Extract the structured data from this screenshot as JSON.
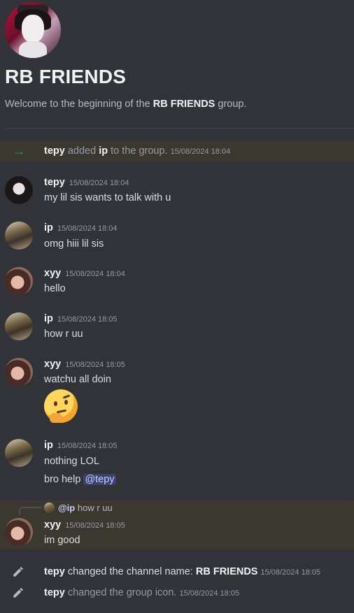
{
  "group": {
    "title": "RB FRIENDS",
    "welcome_prefix": "Welcome to the beginning of the ",
    "welcome_name": "RB FRIENDS",
    "welcome_suffix": " group."
  },
  "system_add": {
    "actor": "tepy",
    "verb": " added ",
    "target": "ip",
    "rest": " to the group.",
    "timestamp": "15/08/2024 18:04"
  },
  "messages": [
    {
      "author": "tepy",
      "timestamp": "15/08/2024 18:04",
      "lines": [
        "my lil sis wants to talk with u"
      ]
    },
    {
      "author": "ip",
      "timestamp": "15/08/2024 18:04",
      "lines": [
        "omg hiii lil sis"
      ]
    },
    {
      "author": "xyy",
      "timestamp": "15/08/2024 18:04",
      "lines": [
        "hello"
      ]
    },
    {
      "author": "ip",
      "timestamp": "15/08/2024 18:05",
      "lines": [
        "how r uu"
      ]
    },
    {
      "author": "xyy",
      "timestamp": "15/08/2024 18:05",
      "lines": [
        "watchu all doin"
      ],
      "emoji": "thinking-face"
    },
    {
      "author": "ip",
      "timestamp": "15/08/2024 18:05",
      "lines": [
        "nothing LOL",
        "bro help "
      ],
      "mention": "@tepy"
    },
    {
      "author": "xyy",
      "timestamp": "15/08/2024 18:05",
      "lines": [
        "im good"
      ],
      "reply_to": {
        "author": "@ip",
        "text": "how r uu"
      }
    }
  ],
  "system_rename": {
    "actor": "tepy",
    "text": " changed the channel name: ",
    "new_name": "RB FRIENDS",
    "timestamp": "15/08/2024 18:05"
  },
  "system_icon": {
    "actor": "tepy",
    "text": " changed the group icon.",
    "timestamp": "15/08/2024 18:05"
  },
  "colors": {
    "background": "#313338",
    "highlight": "#3b3830",
    "join_arrow": "#23a55a",
    "mention_bg": "#3c4270"
  }
}
